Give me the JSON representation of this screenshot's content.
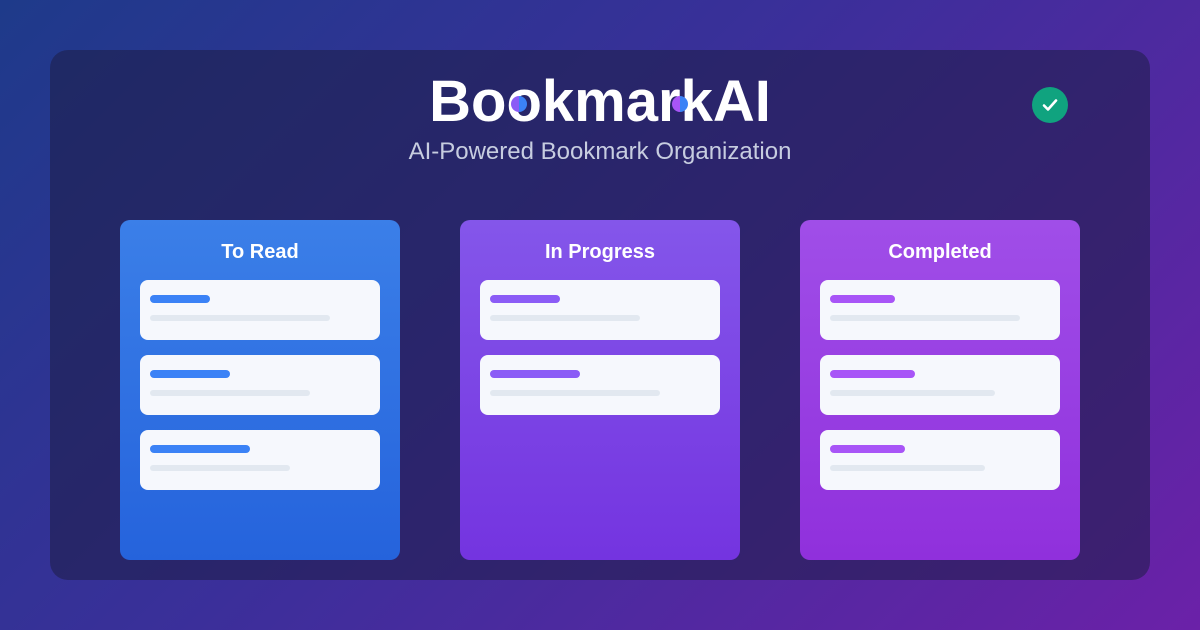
{
  "header": {
    "title": "BookmarkAI",
    "subtitle": "AI-Powered Bookmark Organization",
    "status_icon": "check-circle-icon"
  },
  "colors": {
    "to_read": "#3b82f6",
    "in_progress": "#8b5cf6",
    "completed": "#a855f7",
    "check": "#10a37f"
  },
  "columns": [
    {
      "label": "To Read",
      "card_count": 3
    },
    {
      "label": "In Progress",
      "card_count": 2
    },
    {
      "label": "Completed",
      "card_count": 3
    }
  ]
}
